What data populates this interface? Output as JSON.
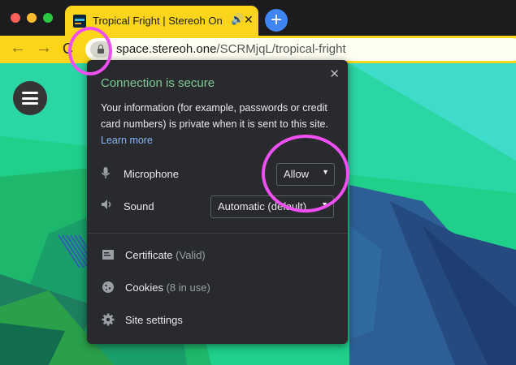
{
  "tab": {
    "title": "Tropical Fright | Stereoh On",
    "audio_icon": "speaker-icon",
    "close_icon": "close-icon"
  },
  "toolbar": {
    "url_host": "space.stereoh.one",
    "url_path": "/SCRMjqL/tropical-fright"
  },
  "popup": {
    "title": "Connection is secure",
    "description": "Your information (for example, passwords or credit card numbers) is private when it is sent to this site.",
    "learn_more": "Learn more",
    "permissions": [
      {
        "label": "Microphone",
        "value": "Allow",
        "icon": "microphone-icon"
      },
      {
        "label": "Sound",
        "value": "Automatic (default)",
        "icon": "speaker-icon"
      }
    ],
    "links": [
      {
        "label": "Certificate",
        "detail": "(Valid)",
        "icon": "certificate-icon"
      },
      {
        "label": "Cookies",
        "detail": "(8 in use)",
        "icon": "cookie-icon"
      },
      {
        "label": "Site settings",
        "detail": "",
        "icon": "gear-icon"
      }
    ]
  },
  "colors": {
    "accent_tab": "#fad51c",
    "secure_title": "#81c995",
    "link": "#8ab4f8",
    "annotation": "#ee4ff1"
  }
}
